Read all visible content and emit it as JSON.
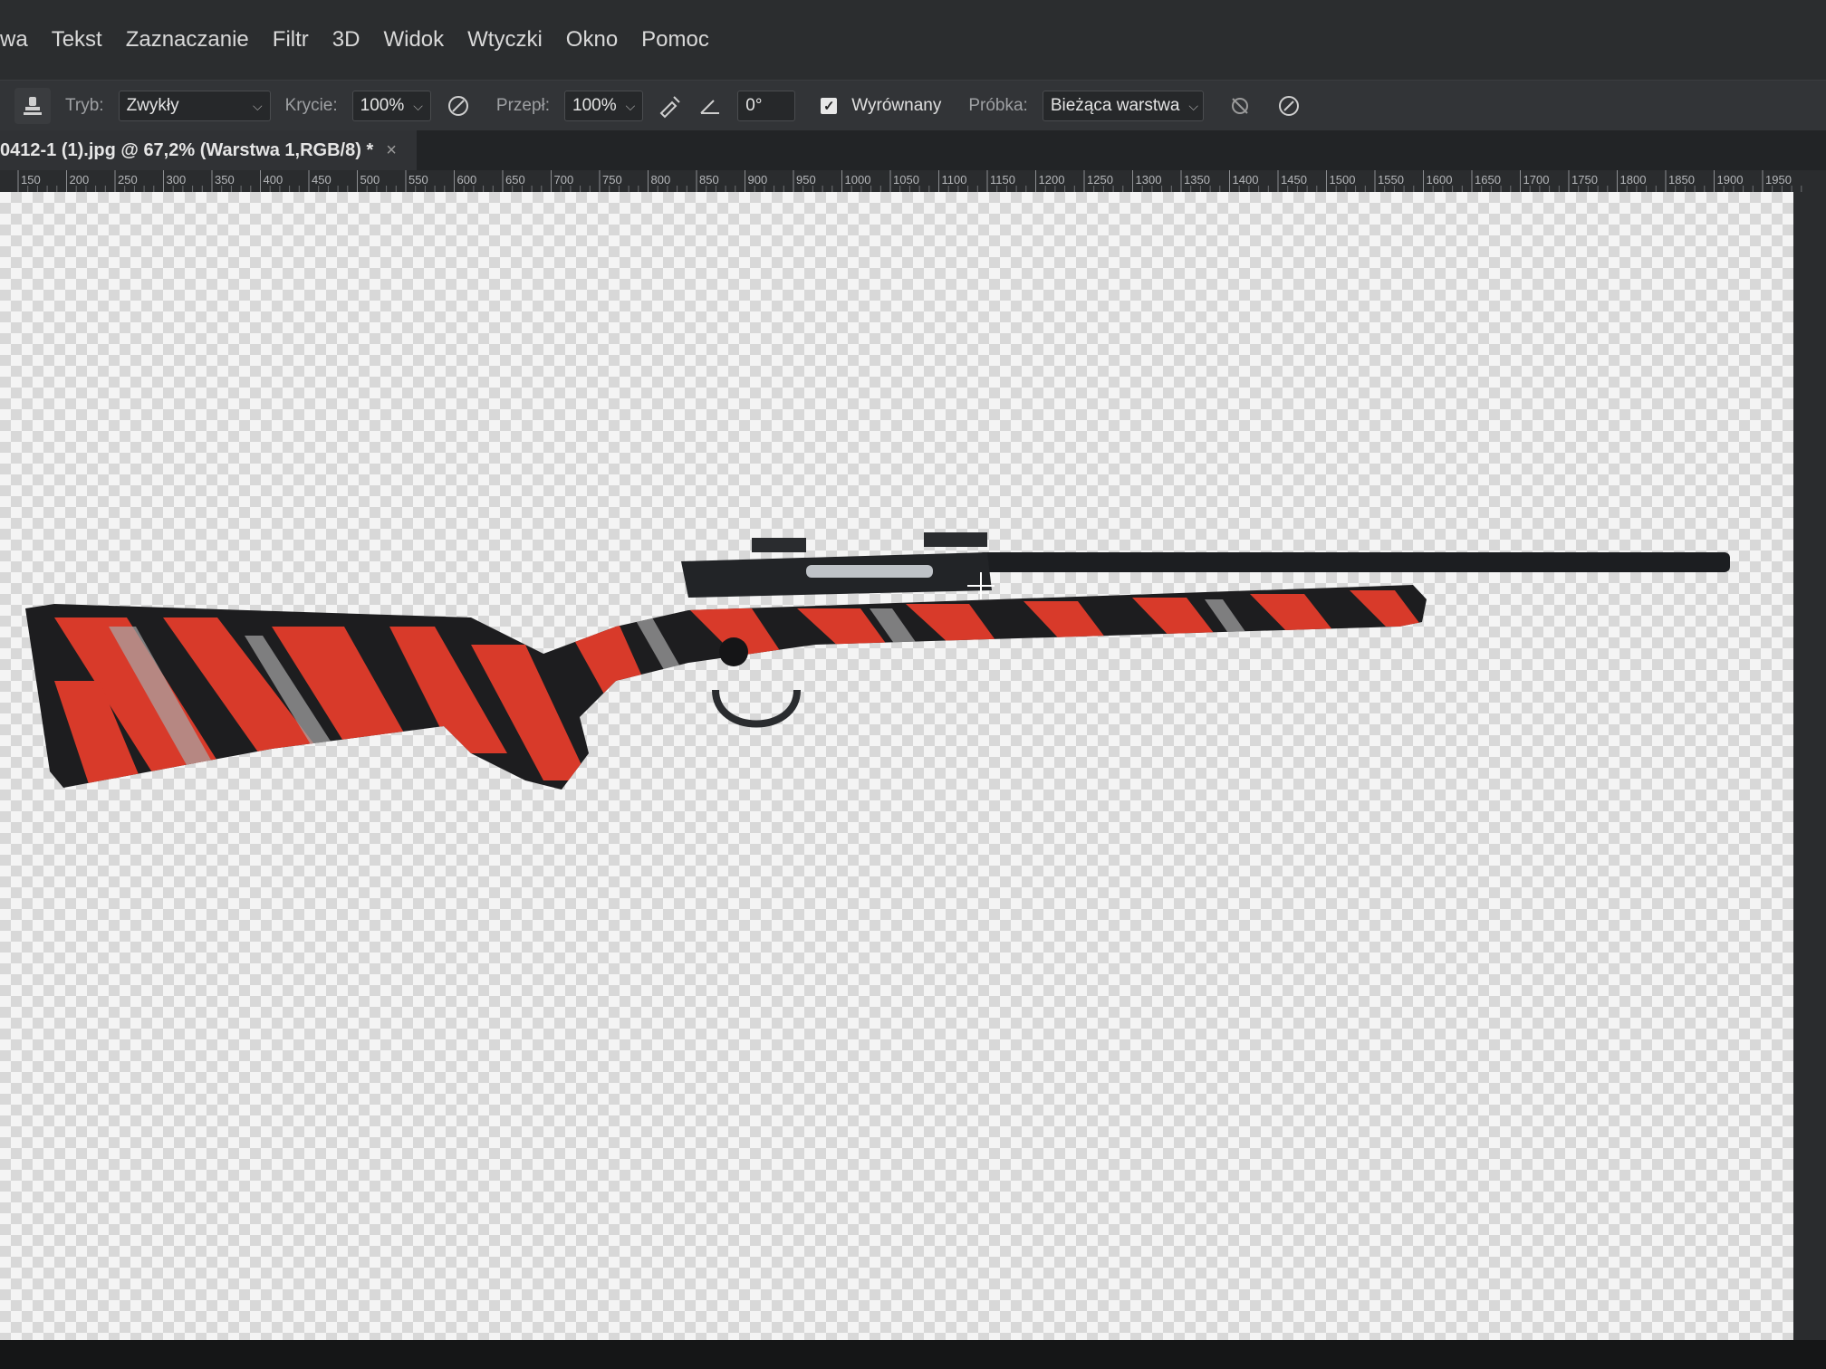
{
  "menu": {
    "items": [
      "wa",
      "Tekst",
      "Zaznaczanie",
      "Filtr",
      "3D",
      "Widok",
      "Wtyczki",
      "Okno",
      "Pomoc"
    ]
  },
  "options": {
    "mode_label": "Tryb:",
    "mode_value": "Zwykły",
    "opacity_label": "Krycie:",
    "opacity_value": "100%",
    "flow_label": "Przepł:",
    "flow_value": "100%",
    "angle_value": "0°",
    "aligned_label": "Wyrównany",
    "aligned_checked": true,
    "sample_label": "Próbka:",
    "sample_value": "Bieżąca warstwa"
  },
  "document": {
    "tab_title": "0412-1 (1).jpg @ 67,2% (Warstwa 1,RGB/8) *",
    "close_glyph": "×"
  },
  "ruler": {
    "ticks": [
      "150",
      "200",
      "250",
      "300",
      "350",
      "400",
      "450",
      "500",
      "550",
      "600",
      "650",
      "700",
      "750",
      "800",
      "850",
      "900",
      "950",
      "1000",
      "1050",
      "1100",
      "1150",
      "1200",
      "1250",
      "1300",
      "1350",
      "1400",
      "1450",
      "1500",
      "1550",
      "1600",
      "1650",
      "1700",
      "1750",
      "1800",
      "1850",
      "1900",
      "1950"
    ]
  },
  "icons": {
    "tool": "clone-stamp-icon",
    "pressure_opacity": "pressure-opacity-icon",
    "airbrush": "airbrush-icon",
    "angle": "angle-icon",
    "ignore_adjustment": "ignore-adjustment-layers-icon",
    "pressure_size": "pressure-size-icon"
  },
  "colors": {
    "camo_red": "#d83a2a",
    "camo_black": "#1d1d1f",
    "camo_grey": "#a8a8a8",
    "barrel": "#1c1e21"
  }
}
